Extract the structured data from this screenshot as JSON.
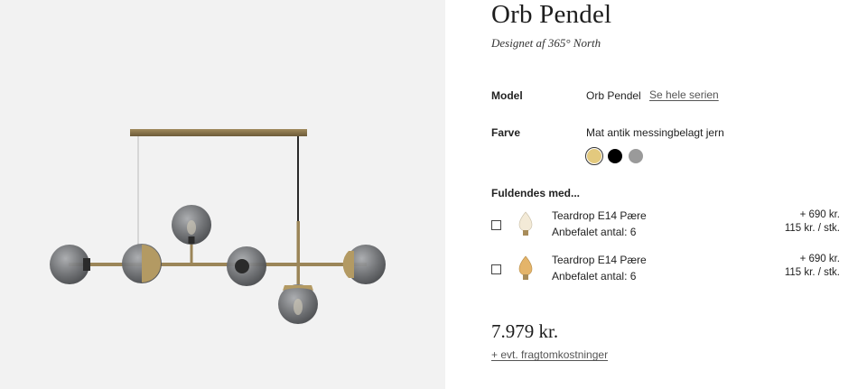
{
  "product": {
    "title": "Orb Pendel",
    "subtitle": "Designet af 365° North"
  },
  "model": {
    "label": "Model",
    "value": "Orb Pendel",
    "series_link": "Se hele serien"
  },
  "color": {
    "label": "Farve",
    "value": "Mat antik messingbelagt jern",
    "swatches": [
      {
        "name": "brass",
        "hex": "#e3c97e",
        "selected": true
      },
      {
        "name": "black",
        "hex": "#000000",
        "selected": false
      },
      {
        "name": "grey",
        "hex": "#9a9a9a",
        "selected": false
      }
    ]
  },
  "addons": {
    "title": "Fuldendes med...",
    "items": [
      {
        "name": "Teardrop E14 Pære",
        "quantity": "Anbefalet antal: 6",
        "price": "+ 690 kr.",
        "unit_price": "115 kr. / stk.",
        "bulb_color": "#f3ead7",
        "icon": "bulb-icon"
      },
      {
        "name": "Teardrop E14 Pære",
        "quantity": "Anbefalet antal: 6",
        "price": "+ 690 kr.",
        "unit_price": "115 kr. / stk.",
        "bulb_color": "#e4b46a",
        "icon": "bulb-icon"
      }
    ]
  },
  "price": "7.979 kr.",
  "shipping_link": "+ evt. fragtomkostninger"
}
